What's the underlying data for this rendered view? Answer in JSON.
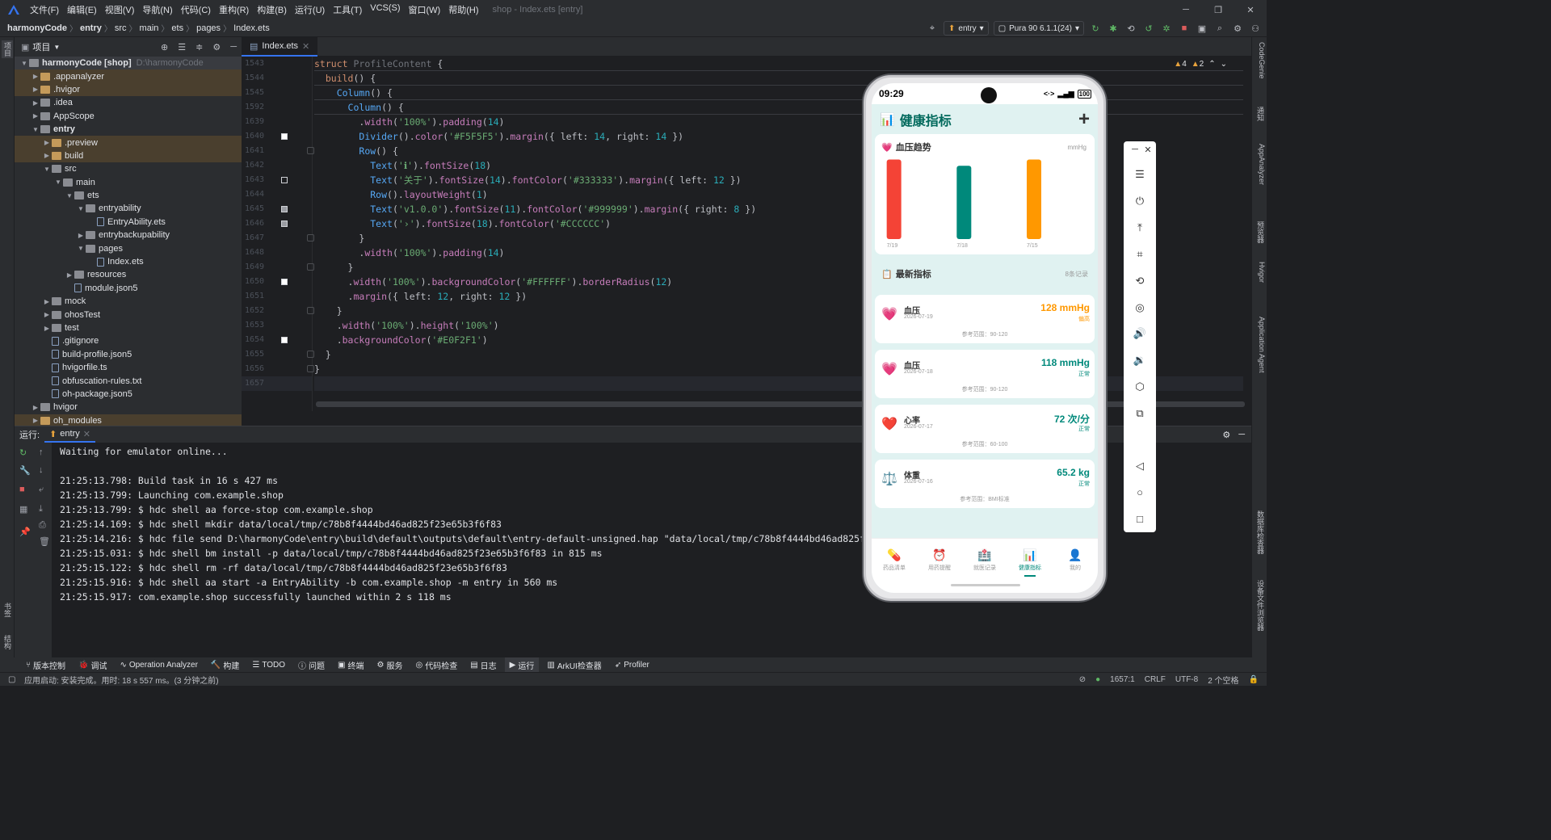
{
  "menubar": {
    "items": [
      "文件(F)",
      "编辑(E)",
      "视图(V)",
      "导航(N)",
      "代码(C)",
      "重构(R)",
      "构建(B)",
      "运行(U)",
      "工具(T)",
      "VCS(S)",
      "窗口(W)",
      "帮助(H)"
    ],
    "window_title": "shop - Index.ets [entry]"
  },
  "breadcrumb": [
    "harmonyCode",
    "entry",
    "src",
    "main",
    "ets",
    "pages",
    "Index.ets"
  ],
  "toolbar": {
    "module": "entry",
    "device": "Pura 90 6.1.1(24)"
  },
  "project_panel": {
    "title": "项目",
    "tree": [
      {
        "name": "harmonyCode [shop]",
        "hint": "D:\\harmonyCode",
        "depth": 0,
        "type": "root",
        "open": true
      },
      {
        "name": ".appanalyzer",
        "depth": 1,
        "type": "folder-orange",
        "open": false
      },
      {
        "name": ".hvigor",
        "depth": 1,
        "type": "folder-orange",
        "open": false
      },
      {
        "name": ".idea",
        "depth": 1,
        "type": "folder",
        "open": false
      },
      {
        "name": "AppScope",
        "depth": 1,
        "type": "folder",
        "open": false
      },
      {
        "name": "entry",
        "depth": 1,
        "type": "folder",
        "open": true,
        "bold": true
      },
      {
        "name": ".preview",
        "depth": 2,
        "type": "folder-orange",
        "open": false
      },
      {
        "name": "build",
        "depth": 2,
        "type": "folder-orange",
        "open": false
      },
      {
        "name": "src",
        "depth": 2,
        "type": "folder",
        "open": true
      },
      {
        "name": "main",
        "depth": 3,
        "type": "folder",
        "open": true
      },
      {
        "name": "ets",
        "depth": 4,
        "type": "folder",
        "open": true
      },
      {
        "name": "entryability",
        "depth": 5,
        "type": "folder",
        "open": true
      },
      {
        "name": "EntryAbility.ets",
        "depth": 6,
        "type": "file"
      },
      {
        "name": "entrybackupability",
        "depth": 5,
        "type": "folder",
        "open": false
      },
      {
        "name": "pages",
        "depth": 5,
        "type": "folder",
        "open": true
      },
      {
        "name": "Index.ets",
        "depth": 6,
        "type": "file"
      },
      {
        "name": "resources",
        "depth": 4,
        "type": "folder",
        "open": false
      },
      {
        "name": "module.json5",
        "depth": 4,
        "type": "file"
      },
      {
        "name": "mock",
        "depth": 2,
        "type": "folder",
        "open": false
      },
      {
        "name": "ohosTest",
        "depth": 2,
        "type": "folder",
        "open": false
      },
      {
        "name": "test",
        "depth": 2,
        "type": "folder",
        "open": false
      },
      {
        "name": ".gitignore",
        "depth": 2,
        "type": "file"
      },
      {
        "name": "build-profile.json5",
        "depth": 2,
        "type": "file"
      },
      {
        "name": "hvigorfile.ts",
        "depth": 2,
        "type": "file"
      },
      {
        "name": "obfuscation-rules.txt",
        "depth": 2,
        "type": "file"
      },
      {
        "name": "oh-package.json5",
        "depth": 2,
        "type": "file"
      },
      {
        "name": "hvigor",
        "depth": 1,
        "type": "folder",
        "open": false
      },
      {
        "name": "oh_modules",
        "depth": 1,
        "type": "folder-orange",
        "open": false
      }
    ]
  },
  "editor": {
    "tab": "Index.ets",
    "warnings": {
      "warn": "4",
      "weak": "2"
    },
    "lines": [
      {
        "n": "1543",
        "code": "struct ProfileContent {",
        "mark": ""
      },
      {
        "n": "1544",
        "code": "  build() {",
        "mark": ""
      },
      {
        "n": "1545",
        "code": "    Column() {",
        "mark": ""
      },
      {
        "n": "1592",
        "code": "      Column() {",
        "mark": ""
      },
      {
        "n": "1639",
        "code": "        .width('100%').padding(14)",
        "mark": ""
      },
      {
        "n": "1640",
        "code": "        Divider().color('#F5F5F5').margin({ left: 14, right: 14 })",
        "mark": "white"
      },
      {
        "n": "1641",
        "code": "        Row() {",
        "mark": ""
      },
      {
        "n": "1642",
        "code": "          Text('ℹ').fontSize(18)",
        "mark": ""
      },
      {
        "n": "1643",
        "code": "          Text('关于').fontSize(14).fontColor('#333333').margin({ left: 12 })",
        "mark": "hollow"
      },
      {
        "n": "1644",
        "code": "          Row().layoutWeight(1)",
        "mark": ""
      },
      {
        "n": "1645",
        "code": "          Text('v1.0.0').fontSize(11).fontColor('#999999').margin({ right: 8 })",
        "mark": "grey"
      },
      {
        "n": "1646",
        "code": "          Text('›').fontSize(18).fontColor('#CCCCCC')",
        "mark": "grey"
      },
      {
        "n": "1647",
        "code": "        }",
        "mark": ""
      },
      {
        "n": "1648",
        "code": "        .width('100%').padding(14)",
        "mark": ""
      },
      {
        "n": "1649",
        "code": "      }",
        "mark": ""
      },
      {
        "n": "1650",
        "code": "      .width('100%').backgroundColor('#FFFFFF').borderRadius(12)",
        "mark": "white"
      },
      {
        "n": "1651",
        "code": "      .margin({ left: 12, right: 12 })",
        "mark": ""
      },
      {
        "n": "1652",
        "code": "    }",
        "mark": ""
      },
      {
        "n": "1653",
        "code": "    .width('100%').height('100%')",
        "mark": ""
      },
      {
        "n": "1654",
        "code": "    .backgroundColor('#E0F2F1')",
        "mark": "white"
      },
      {
        "n": "1655",
        "code": "  }",
        "mark": ""
      },
      {
        "n": "1656",
        "code": "}",
        "mark": ""
      },
      {
        "n": "1657",
        "code": "",
        "mark": ""
      }
    ]
  },
  "run_panel": {
    "label": "运行:",
    "tab": "entry",
    "lines": [
      "Waiting for emulator online...",
      "",
      "21:25:13.798: Build task in 16 s 427 ms",
      "21:25:13.799: Launching com.example.shop",
      "21:25:13.799: $ hdc shell aa force-stop com.example.shop",
      "21:25:14.169: $ hdc shell mkdir data/local/tmp/c78b8f4444bd46ad825f23e65b3f6f83",
      "21:25:14.216: $ hdc file send D:\\harmonyCode\\entry\\build\\default\\outputs\\default\\entry-default-unsigned.hap \"data/local/tmp/c78b8f4444bd46ad825f23e65b3f",
      "21:25:15.031: $ hdc shell bm install -p data/local/tmp/c78b8f4444bd46ad825f23e65b3f6f83 in 815 ms",
      "21:25:15.122: $ hdc shell rm -rf data/local/tmp/c78b8f4444bd46ad825f23e65b3f6f83",
      "21:25:15.916: $ hdc shell aa start -a EntryAbility -b com.example.shop -m entry in 560 ms",
      "21:25:15.917: com.example.shop successfully launched within 2 s 118 ms"
    ]
  },
  "bottom_tools": [
    "版本控制",
    "调试",
    "Operation Analyzer",
    "构建",
    "TODO",
    "问题",
    "终端",
    "服务",
    "代码检查",
    "日志",
    "运行",
    "ArkUI检查器",
    "Profiler"
  ],
  "status": {
    "message": "应用启动: 安装完成。用时: 18 s 557 ms。(3 分钟之前)",
    "position": "1657:1",
    "line_sep": "CRLF",
    "encoding": "UTF-8",
    "indent": "2 个空格"
  },
  "left_strip": [
    "项目",
    "书签",
    "结构"
  ],
  "right_strip": [
    "CodeGenie",
    "通知",
    "AppAnalyzer",
    "预览器",
    "Hvigor",
    "Application Agent",
    "数据库检查器",
    "设备文件浏览器"
  ],
  "phone": {
    "time": "09:29",
    "battery": "100",
    "app_title": "健康指标",
    "chart": {
      "title": "血压趋势",
      "unit": "mmHg",
      "type": "bar",
      "categories": [
        "7/19",
        "7/18",
        "7/15"
      ],
      "values": [
        128,
        118,
        128
      ],
      "colors": [
        "#f44336",
        "#00897b",
        "#ff9800"
      ],
      "ylim": [
        0,
        130
      ]
    },
    "latest_title": "最新指标",
    "latest_count": "8条记录",
    "metrics": [
      {
        "icon": "💗",
        "name": "血压",
        "date": "2026-07-19",
        "value": "128 mmHg",
        "status": "偏高",
        "ref": "参考范围：90-120",
        "color": "#ff9800"
      },
      {
        "icon": "💗",
        "name": "血压",
        "date": "2026-07-18",
        "value": "118 mmHg",
        "status": "正常",
        "ref": "参考范围：90-120",
        "color": "#00897b"
      },
      {
        "icon": "❤️",
        "name": "心率",
        "date": "2026-07-17",
        "value": "72 次/分",
        "status": "正常",
        "ref": "参考范围：60-100",
        "color": "#00897b"
      },
      {
        "icon": "⚖️",
        "name": "体重",
        "date": "2026-07-16",
        "value": "65.2 kg",
        "status": "正常",
        "ref": "参考范围：BMI标准",
        "color": "#00897b"
      }
    ],
    "tabs": [
      {
        "icon": "💊",
        "label": "药品清单",
        "active": false
      },
      {
        "icon": "⏰",
        "label": "用药提醒",
        "active": false
      },
      {
        "icon": "🏥",
        "label": "就医记录",
        "active": false
      },
      {
        "icon": "📊",
        "label": "健康指标",
        "active": true
      },
      {
        "icon": "👤",
        "label": "我的",
        "active": false
      }
    ]
  }
}
